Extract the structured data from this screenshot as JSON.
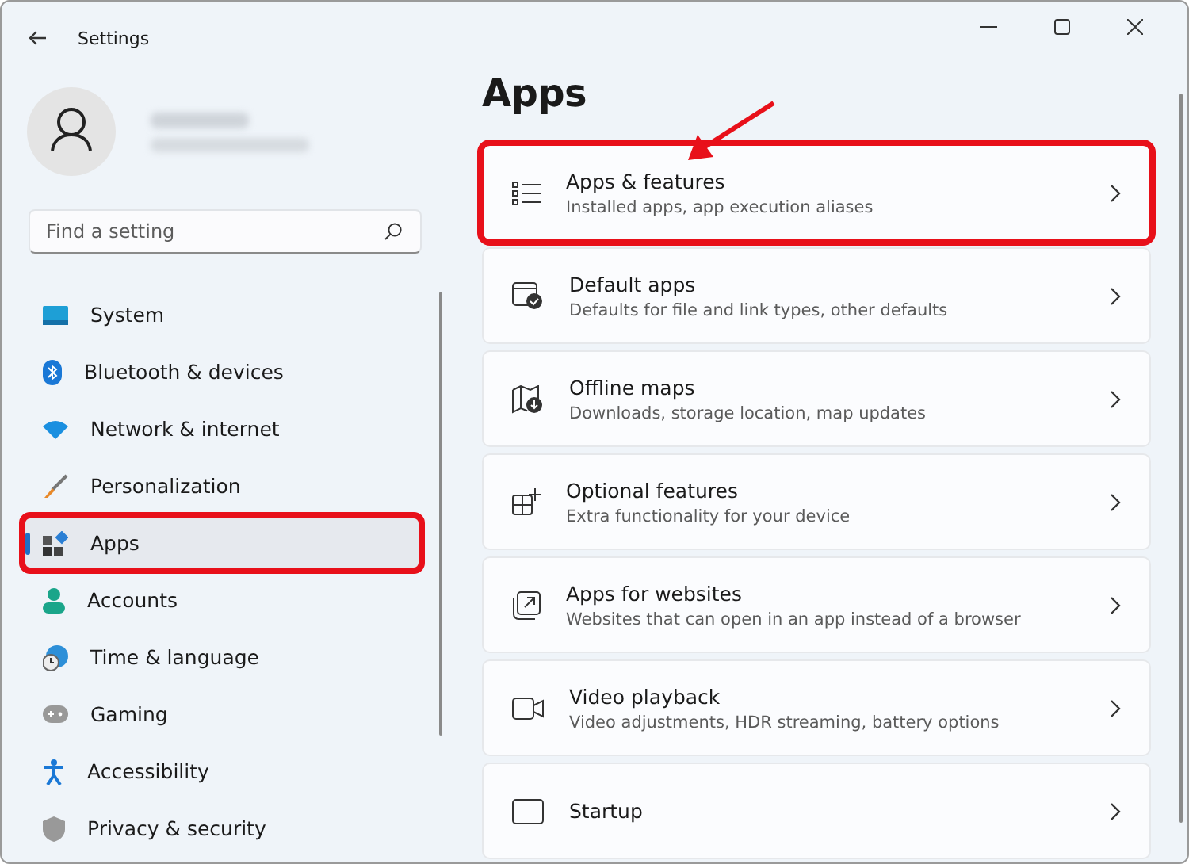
{
  "window": {
    "title": "Settings"
  },
  "search": {
    "placeholder": "Find a setting"
  },
  "sidebar": {
    "items": [
      {
        "label": "System",
        "selected": false,
        "highlighted": false
      },
      {
        "label": "Bluetooth & devices",
        "selected": false,
        "highlighted": false
      },
      {
        "label": "Network & internet",
        "selected": false,
        "highlighted": false
      },
      {
        "label": "Personalization",
        "selected": false,
        "highlighted": false
      },
      {
        "label": "Apps",
        "selected": true,
        "highlighted": true
      },
      {
        "label": "Accounts",
        "selected": false,
        "highlighted": false
      },
      {
        "label": "Time & language",
        "selected": false,
        "highlighted": false
      },
      {
        "label": "Gaming",
        "selected": false,
        "highlighted": false
      },
      {
        "label": "Accessibility",
        "selected": false,
        "highlighted": false
      },
      {
        "label": "Privacy & security",
        "selected": false,
        "highlighted": false
      }
    ]
  },
  "page": {
    "title": "Apps",
    "cards": [
      {
        "title": "Apps & features",
        "subtitle": "Installed apps, app execution aliases",
        "highlighted": true
      },
      {
        "title": "Default apps",
        "subtitle": "Defaults for file and link types, other defaults",
        "highlighted": false
      },
      {
        "title": "Offline maps",
        "subtitle": "Downloads, storage location, map updates",
        "highlighted": false
      },
      {
        "title": "Optional features",
        "subtitle": "Extra functionality for your device",
        "highlighted": false
      },
      {
        "title": "Apps for websites",
        "subtitle": "Websites that can open in an app instead of a browser",
        "highlighted": false
      },
      {
        "title": "Video playback",
        "subtitle": "Video adjustments, HDR streaming, battery options",
        "highlighted": false
      },
      {
        "title": "Startup",
        "highlighted": false
      }
    ]
  }
}
